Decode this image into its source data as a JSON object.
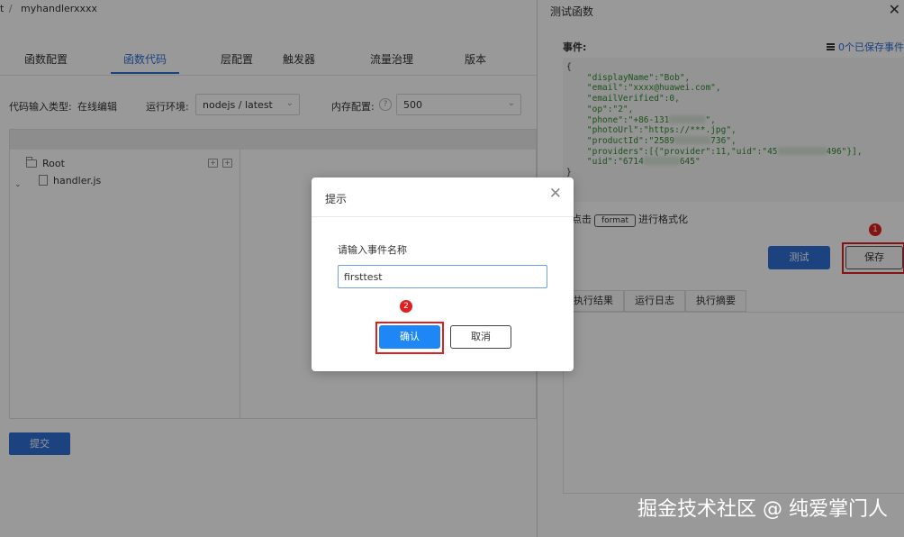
{
  "breadcrumb": {
    "prefix": "t",
    "sep": "/",
    "current": "myhandlerxxxx"
  },
  "tabs": [
    "函数配置",
    "函数代码",
    "层配置",
    "触发器",
    "流量治理",
    "版本"
  ],
  "config": {
    "input_type_label": "代码输入类型:",
    "input_type_value": "在线编辑",
    "runtime_label": "运行环境:",
    "runtime_value": "nodejs / latest",
    "memory_label": "内存配置:",
    "memory_value": "500",
    "help_symbol": "?"
  },
  "file_tree": {
    "root": "Root",
    "file": "handler.js",
    "arrow": "⌄"
  },
  "submit_label": "提交",
  "drawer": {
    "title": "测试函数",
    "close": "✕",
    "event_label": "事件:",
    "saved_events": "0个已保存事件",
    "format_hint_prefix": "点击",
    "format_button": "format",
    "format_hint_suffix": "进行格式化",
    "test_label": "测试",
    "save_label": "保存",
    "result_tabs": [
      "执行结果",
      "运行日志",
      "执行摘要"
    ],
    "badge_save": "1"
  },
  "code": {
    "open": "{",
    "display_name": "\"displayName\":\"Bob\",",
    "email": "\"email\":\"xxxx@huawei.com\",",
    "email_verified": "\"emailVerified\":0,",
    "op": "\"op\":\"2\",",
    "phone_prefix": "\"phone\":\"+86-131",
    "phone_suffix": "\",",
    "photo_url": "\"photoUrl\":\"https://***.jpg\",",
    "product_prefix": "\"productId\":\"2589",
    "product_suffix": "736\",",
    "providers_prefix": "\"providers\":[{\"provider\":11,\"uid\":\"45",
    "providers_suffix": "496\"}],",
    "uid_prefix": "\"uid\":\"6714",
    "uid_suffix": "645\"",
    "close": "}"
  },
  "dialog": {
    "title": "提示",
    "close": "✕",
    "label": "请输入事件名称",
    "input_value": "firsttest",
    "confirm_label": "确认",
    "cancel_label": "取消",
    "badge_confirm": "2"
  },
  "watermark": "掘金技术社区 @ 纯爱掌门人",
  "colors": {
    "accent": "#2f6fd6",
    "confirm": "#1f87f5",
    "highlight": "#e02020",
    "overlay": "rgba(0,0,0,0.40)"
  }
}
